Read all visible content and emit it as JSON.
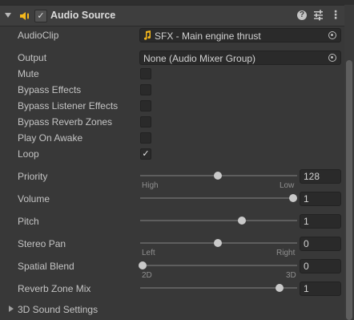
{
  "component": {
    "title": "Audio Source",
    "enabled_mark": "✓",
    "help_icon": "?",
    "more_icon": "⋮"
  },
  "fields": {
    "audio_clip": {
      "label": "AudioClip",
      "value": "SFX - Main engine thrust"
    },
    "output": {
      "label": "Output",
      "value": "None (Audio Mixer Group)"
    },
    "mute": {
      "label": "Mute",
      "checked": false
    },
    "bypass_effects": {
      "label": "Bypass Effects",
      "checked": false
    },
    "bypass_listener_effects": {
      "label": "Bypass Listener Effects",
      "checked": false
    },
    "bypass_reverb_zones": {
      "label": "Bypass Reverb Zones",
      "checked": false
    },
    "play_on_awake": {
      "label": "Play On Awake",
      "checked": false
    },
    "loop": {
      "label": "Loop",
      "checked": true,
      "mark": "✓"
    }
  },
  "sliders": {
    "priority": {
      "label": "Priority",
      "value": "128",
      "level": 0.502,
      "left": "High",
      "right": "Low"
    },
    "volume": {
      "label": "Volume",
      "value": "1",
      "level": 1.0
    },
    "pitch": {
      "label": "Pitch",
      "value": "1",
      "level": 0.66
    },
    "stereo_pan": {
      "label": "Stereo Pan",
      "value": "0",
      "level": 0.5,
      "left": "Left",
      "right": "Right"
    },
    "spatial_blend": {
      "label": "Spatial Blend",
      "value": "0",
      "level": 0.0,
      "left": "2D",
      "right": "3D"
    },
    "reverb_zone_mix": {
      "label": "Reverb Zone Mix",
      "value": "1",
      "level": 0.91
    }
  },
  "foldout": {
    "label": "3D Sound Settings",
    "expanded": false
  },
  "colors": {
    "background": "#383838",
    "header": "#3e3e3e",
    "field": "#2a2a2a",
    "speaker": "#f5b81c"
  }
}
